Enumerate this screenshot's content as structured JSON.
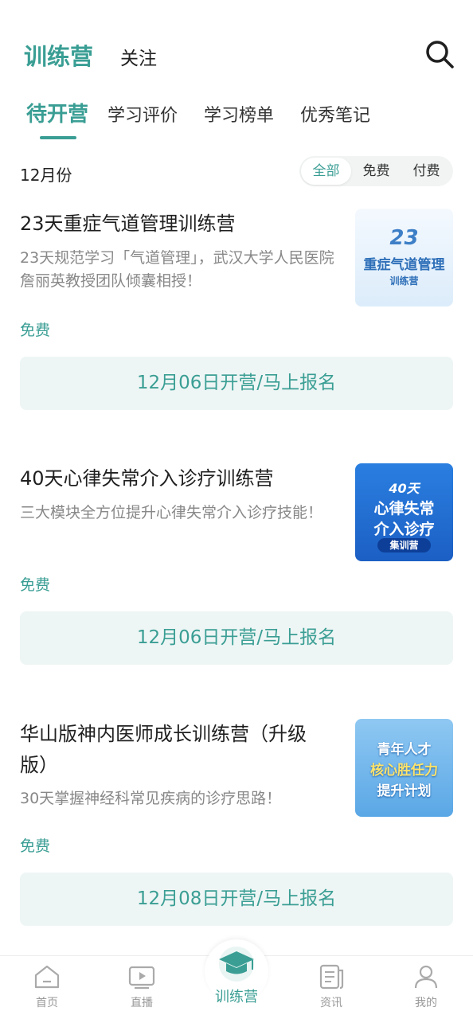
{
  "header": {
    "title": "训练营",
    "follow": "关注",
    "search_icon": "search-icon"
  },
  "tabs": [
    {
      "label": "待开营",
      "active": true
    },
    {
      "label": "学习评价",
      "active": false
    },
    {
      "label": "学习榜单",
      "active": false
    },
    {
      "label": "优秀笔记",
      "active": false
    }
  ],
  "month": "12月份",
  "filter": [
    {
      "label": "全部",
      "active": true
    },
    {
      "label": "免费",
      "active": false
    },
    {
      "label": "付费",
      "active": false
    }
  ],
  "camps": [
    {
      "title": "23天重症气道管理训练营",
      "desc": "23天规范学习「气道管理」，武汉大学人民医院詹丽英教授团队倾囊相授！",
      "price": "免费",
      "button": "12月06日开营/马上报名",
      "thumb": {
        "line1": "23",
        "line2": "重症气道管理",
        "line3": "训练营"
      }
    },
    {
      "title": "40天心律失常介入诊疗训练营",
      "desc": "三大模块全方位提升心律失常介入诊疗技能！",
      "price": "免费",
      "button": "12月06日开营/马上报名",
      "thumb": {
        "line1": "40天",
        "line2": "心律失常",
        "line3": "介入诊疗",
        "line4": "集训营"
      }
    },
    {
      "title": "华山版神内医师成长训练营（升级版）",
      "desc": "30天掌握神经科常见疾病的诊疗思路！",
      "price": "免费",
      "button": "12月08日开营/马上报名",
      "thumb": {
        "line1": "青年人才",
        "line2": "核心胜任力",
        "line3": "提升计划"
      }
    }
  ],
  "tabbar": [
    {
      "label": "首页",
      "icon": "home-icon"
    },
    {
      "label": "直播",
      "icon": "live-icon"
    },
    {
      "label": "训练营",
      "icon": "graduation-cap-icon",
      "active": true
    },
    {
      "label": "资讯",
      "icon": "news-icon"
    },
    {
      "label": "我的",
      "icon": "profile-icon"
    }
  ],
  "colors": {
    "accent": "#3a9e94",
    "button_bg": "#eef6f5",
    "muted": "#888888"
  }
}
